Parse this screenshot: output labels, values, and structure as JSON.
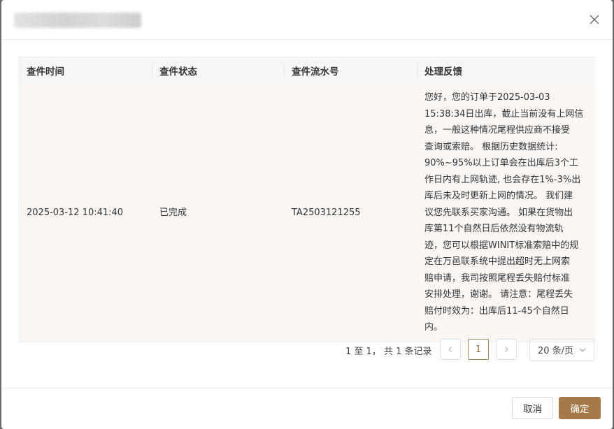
{
  "header": {
    "close_icon": "close-icon"
  },
  "table": {
    "columns": [
      "查件时间",
      "查件状态",
      "查件流水号",
      "处理反馈"
    ],
    "rows": [
      {
        "time": "2025-03-12 10:41:40",
        "status": "已完成",
        "serial": "TA2503121255",
        "feedback": "您好，您的订单于2025-03-03\n15:38:34日出库，截止当前没有上网信\n息，一般这种情况尾程供应商不接受\n查询或索赔。 根据历史数据统计:\n90%~95%以上订单会在出库后3个工\n作日内有上网轨迹, 也会存在1%-3%出\n库后未及时更新上网的情况。 我们建\n议您先联系买家沟通。 如果在货物出\n库第11个自然日后依然没有物流轨\n迹，您可以根据WINIT标准索赔中的规\n定在万邑联系统中提出超时无上网索\n赔申请，我司按照尾程丢失赔付标准\n安排处理，谢谢。 请注意：尾程丢失\n赔付时效为：出库后11-45个自然日\n内。"
      }
    ]
  },
  "pagination": {
    "summary": "1 至 1，  共 1 条记录",
    "prev_icon": "chevron-left-icon",
    "current_page": "1",
    "next_icon": "chevron-right-icon",
    "page_size": "20 条/页"
  },
  "footer": {
    "cancel_label": "取消",
    "ok_label": "确定"
  },
  "colors": {
    "accent": "#a57a48",
    "row_bg": "#faf6f3",
    "header_bg": "#f6f6f6"
  }
}
